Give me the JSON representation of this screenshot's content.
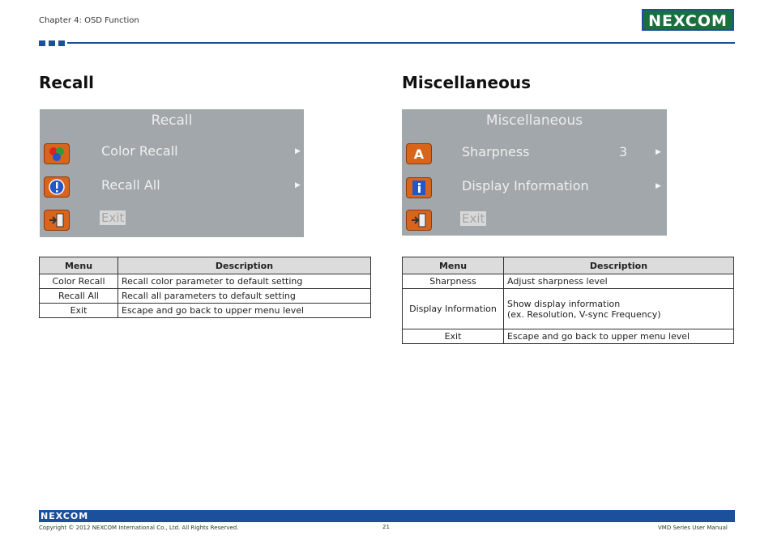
{
  "header": {
    "chapter": "Chapter 4: OSD Function",
    "logo": "NEXCOM"
  },
  "sections": [
    {
      "title": "Recall",
      "osd": {
        "title": "Recall",
        "items": [
          {
            "icon": "color-balls-icon",
            "label": "Color Recall",
            "value": ""
          },
          {
            "icon": "warning-icon",
            "label": "Recall All",
            "value": ""
          }
        ],
        "exit": "Exit"
      },
      "table": {
        "headers": [
          "Menu",
          "Description"
        ],
        "rows": [
          {
            "menu": "Color Recall",
            "desc": "Recall color parameter to default setting",
            "desc2": ""
          },
          {
            "menu": "Recall All",
            "desc": "Recall all parameters to default setting",
            "desc2": ""
          },
          {
            "menu": "Exit",
            "desc": "Escape and go back to upper menu level",
            "desc2": ""
          }
        ]
      }
    },
    {
      "title": "Miscellaneous",
      "osd": {
        "title": "Miscellaneous",
        "items": [
          {
            "icon": "letter-a-icon",
            "label": "Sharpness",
            "value": "3"
          },
          {
            "icon": "info-icon",
            "label": "Display Information",
            "value": ""
          }
        ],
        "exit": "Exit"
      },
      "table": {
        "headers": [
          "Menu",
          "Description"
        ],
        "rows": [
          {
            "menu": "Sharpness",
            "desc": "Adjust sharpness level",
            "desc2": ""
          },
          {
            "menu": "Display Information",
            "desc": "Show display information",
            "desc2": "(ex. Resolution, V-sync Frequency)"
          },
          {
            "menu": "Exit",
            "desc": "Escape and go back to upper menu level",
            "desc2": ""
          }
        ]
      }
    }
  ],
  "footer": {
    "logo": "NEXCOM",
    "copyright": "Copyright © 2012 NEXCOM International Co., Ltd. All Rights Reserved.",
    "page": "21",
    "manual": "VMD Series User Manual"
  },
  "colors": {
    "brand_blue": "#1c4f9c",
    "brand_green": "#1b6e3e",
    "osd_bg": "#a1a7ab",
    "osd_icon": "#d9651c"
  }
}
